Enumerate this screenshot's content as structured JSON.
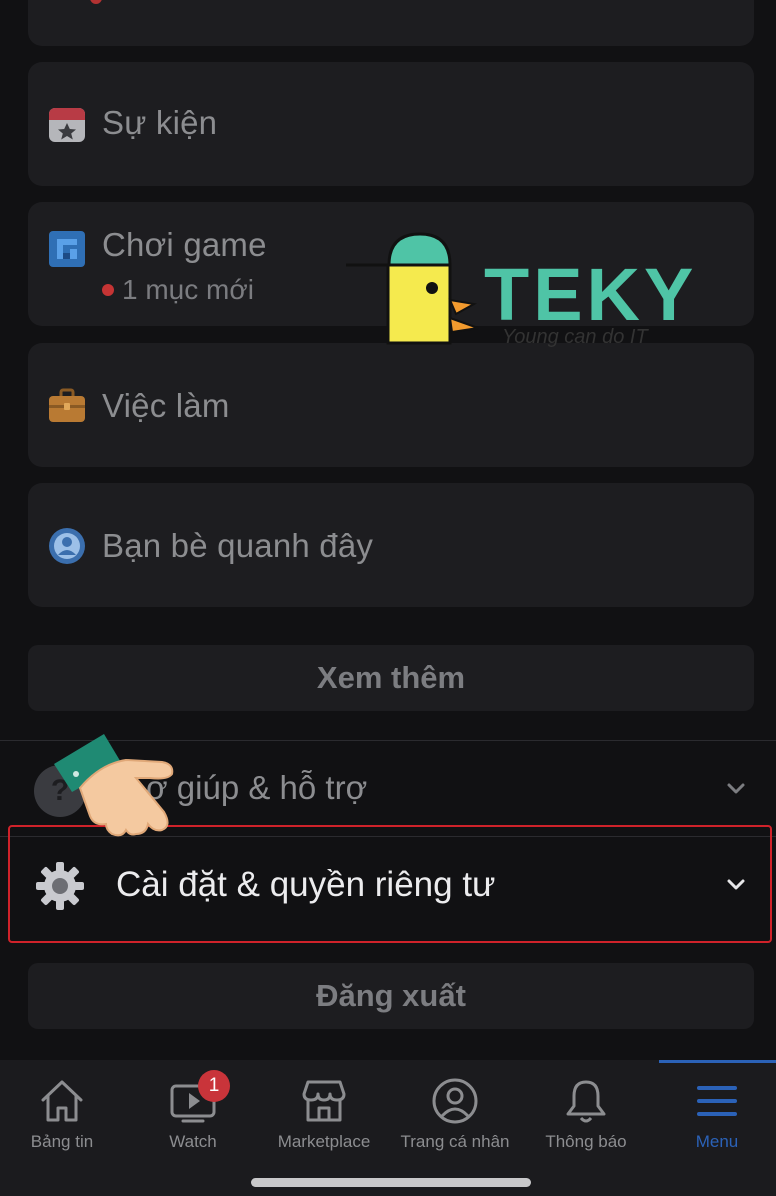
{
  "menu_cards": {
    "events": {
      "label": "Sự kiện",
      "icon": "calendar-star-icon"
    },
    "games": {
      "label": "Chơi game",
      "sub": "1 mục mới",
      "icon": "game-icon"
    },
    "jobs": {
      "label": "Việc làm",
      "icon": "briefcase-icon"
    },
    "nearby": {
      "label": "Bạn bè quanh đây",
      "icon": "nearby-friends-icon"
    }
  },
  "see_more_label": "Xem thêm",
  "help_section": {
    "label": "Trợ giúp & hỗ trợ",
    "visible_label": "ợ giúp & hỗ trợ",
    "icon": "question-circle-icon"
  },
  "settings_section": {
    "label": "Cài đặt & quyền riêng tư",
    "icon": "gear-icon"
  },
  "logout_label": "Đăng xuất",
  "watermark": {
    "brand": "TEKY",
    "slogan": "Young can do IT"
  },
  "tabbar": {
    "tabs": [
      {
        "label": "Bảng tin",
        "icon": "home-icon"
      },
      {
        "label": "Watch",
        "icon": "watch-video-icon",
        "badge": "1"
      },
      {
        "label": "Marketplace",
        "icon": "marketplace-store-icon"
      },
      {
        "label": "Trang cá nhân",
        "icon": "profile-icon"
      },
      {
        "label": "Thông báo",
        "icon": "bell-icon"
      },
      {
        "label": "Menu",
        "icon": "menu-hamburger-icon",
        "active": true
      }
    ]
  },
  "colors": {
    "background": "#111113",
    "card": "#1d1d20",
    "text_muted": "#8c8d90",
    "active_tab": "#2b62b8",
    "highlight": "#d0222a",
    "badge": "#c9343a"
  }
}
